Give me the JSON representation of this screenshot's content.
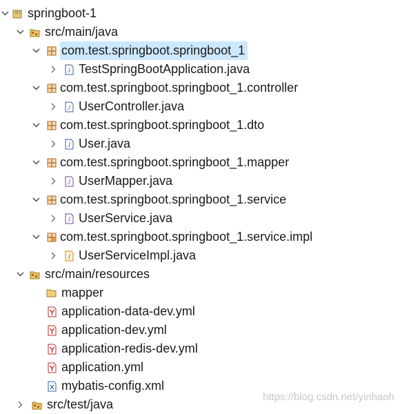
{
  "tree": {
    "project": {
      "label": "springboot-1",
      "icon": "maven-project-icon"
    },
    "src_main_java": {
      "label": "src/main/java",
      "icon": "source-folder-icon"
    },
    "pkg_root": {
      "label": "com.test.springboot.springboot_1",
      "icon": "package-icon",
      "selected": true
    },
    "file_app": {
      "label": "TestSpringBootApplication.java",
      "icon": "java-file-icon"
    },
    "pkg_controller": {
      "label": "com.test.springboot.springboot_1.controller",
      "icon": "package-icon"
    },
    "file_controller": {
      "label": "UserController.java",
      "icon": "java-file-icon"
    },
    "pkg_dto": {
      "label": "com.test.springboot.springboot_1.dto",
      "icon": "package-icon"
    },
    "file_user": {
      "label": "User.java",
      "icon": "java-file-icon"
    },
    "pkg_mapper": {
      "label": "com.test.springboot.springboot_1.mapper",
      "icon": "package-icon"
    },
    "file_mapper": {
      "label": "UserMapper.java",
      "icon": "java-interface-file-icon"
    },
    "pkg_service": {
      "label": "com.test.springboot.springboot_1.service",
      "icon": "package-icon"
    },
    "file_service": {
      "label": "UserService.java",
      "icon": "java-interface-file-icon"
    },
    "pkg_service_impl": {
      "label": "com.test.springboot.springboot_1.service.impl",
      "icon": "package-icon"
    },
    "file_service_impl": {
      "label": "UserServiceImpl.java",
      "icon": "java-file-icon"
    },
    "src_main_resources": {
      "label": "src/main/resources",
      "icon": "source-folder-icon"
    },
    "folder_mapper": {
      "label": "mapper",
      "icon": "folder-icon"
    },
    "yml_data_dev": {
      "label": "application-data-dev.yml",
      "icon": "yml-file-icon"
    },
    "yml_dev": {
      "label": "application-dev.yml",
      "icon": "yml-file-icon"
    },
    "yml_redis_dev": {
      "label": "application-redis-dev.yml",
      "icon": "yml-file-icon"
    },
    "yml_app": {
      "label": "application.yml",
      "icon": "yml-file-icon"
    },
    "xml_mybatis": {
      "label": "mybatis-config.xml",
      "icon": "xml-file-icon"
    },
    "src_test_java": {
      "label": "src/test/java",
      "icon": "source-folder-icon"
    }
  },
  "watermark": "https://blog.csdn.net/yinhaoh",
  "colors": {
    "selection": "#cce8ff",
    "package": "#b5651d",
    "java": "#3a5fa8",
    "yml": "#c62828"
  }
}
